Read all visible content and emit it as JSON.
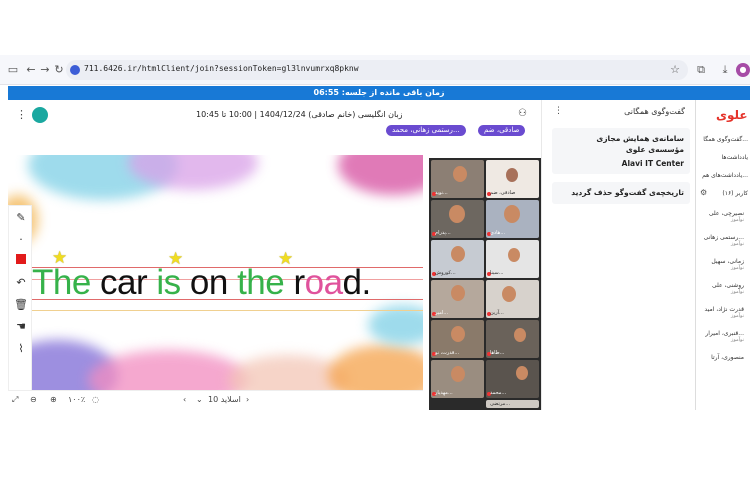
{
  "browser": {
    "url": "711.6426.ir/htmlClient/join?sessionToken=gl3lnvumrxq8pknw"
  },
  "session": {
    "timer_label": "زمان باقی مانده از جلسه: 06:55",
    "meeting_info": "زبان انگلیسی (خانم صادقی) 1404/12/24 | 10:00 تا 10:45",
    "pill_1": "صادقی، ضم",
    "pill_2": "رستمی زهانی، محمد..."
  },
  "slide": {
    "words": [
      {
        "text": "The",
        "color": "#36b24a"
      },
      {
        "text": " car ",
        "color": "#111111"
      },
      {
        "text": "is",
        "color": "#36b24a"
      },
      {
        "text": " on ",
        "color": "#111111"
      },
      {
        "text": "the",
        "color": "#36b24a"
      },
      {
        "text": " r",
        "color": "#111111"
      },
      {
        "text": "oa",
        "color": "#e0529c"
      },
      {
        "text": "d.",
        "color": "#111111"
      }
    ],
    "slide_label": "اسلاید 10",
    "zoom_label": "۱۰۰٪"
  },
  "tiles": [
    {
      "name": "نوید..."
    },
    {
      "name": "صادقی، ضم"
    },
    {
      "name": "پدرام..."
    },
    {
      "name": "هادی..."
    },
    {
      "name": "کوروش..."
    },
    {
      "name": "سینا..."
    },
    {
      "name": "امیر..."
    },
    {
      "name": "آرین..."
    },
    {
      "name": "قدرت، نو..."
    },
    {
      "name": "طاها..."
    },
    {
      "name": "مهدیار..."
    },
    {
      "name": "محمد..."
    },
    {
      "name": "مرتضی..."
    }
  ],
  "chat": {
    "header": "گفت‌وگوی همگانی",
    "welcome_title": "سامانه‌ی همایش مجازی مؤسسه‌ی علوی",
    "welcome_brand": "Alavi IT Center",
    "clear_history": "تاریخچه‌ی گفت‌وگو حذف گردید"
  },
  "right_panel": {
    "logo": "علوی",
    "tab_chat": "گفت‌وگوی همگا...",
    "tab_notes": "یادداشت‌ها",
    "tab_shared": "یادداشت‌های هم...",
    "count": "(۱۶) کاربر",
    "participants": [
      {
        "name": "نصیرچی، علی",
        "role": "نوآموز"
      },
      {
        "name": "رستمی زهانی...",
        "role": "نوآموز"
      },
      {
        "name": "زمانی، سهیل",
        "role": "نوآموز"
      },
      {
        "name": "روشنی، علی",
        "role": "نوآموز"
      },
      {
        "name": "قدرت نژاد، امید",
        "role": "نوآموز"
      },
      {
        "name": "قنبری، امیرار...",
        "role": "نوآموز"
      },
      {
        "name": "منصوری، آرتا",
        "role": ""
      }
    ]
  }
}
